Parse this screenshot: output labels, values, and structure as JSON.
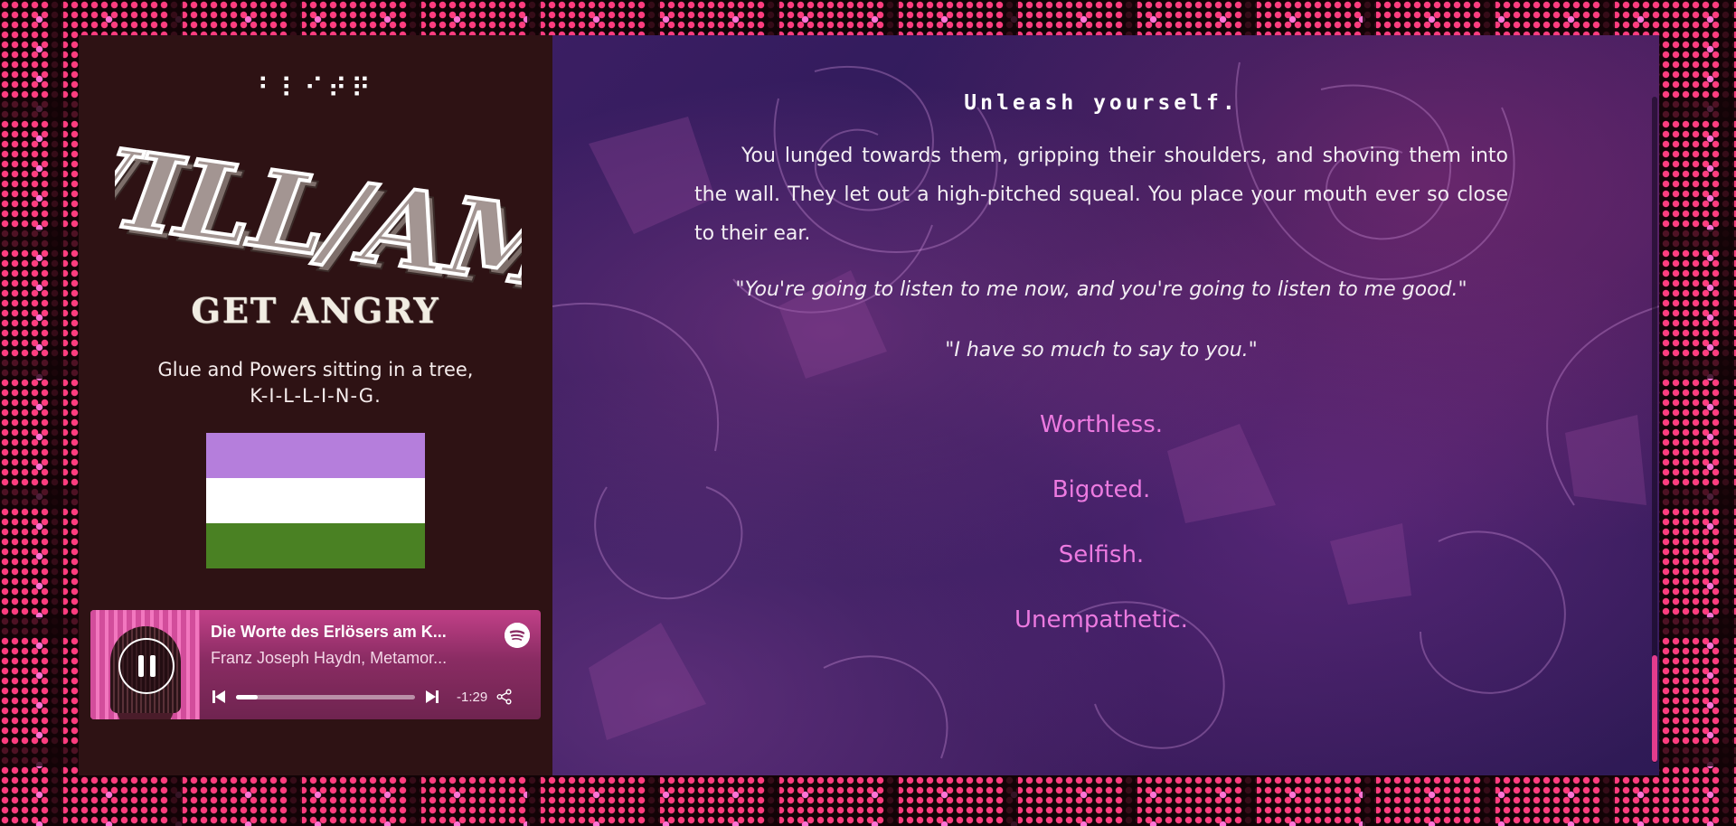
{
  "header": {
    "braille": "⠃⠇⠊⠞⠟",
    "logo_text": "WILL/AM",
    "mood_title": "GET ANGRY",
    "tagline_line1": "Glue and Powers sitting in a tree,",
    "tagline_line2": "K-I-L-L-I-N-G."
  },
  "flag": {
    "stripes": [
      "#b57edc",
      "#ffffff",
      "#4a8123"
    ]
  },
  "player": {
    "track_title": "Die Worte des Erlösers am K...",
    "track_artist": "Franz Joseph Haydn, Metamor...",
    "time_remaining": "-1:29",
    "progress": 0.12,
    "icons": [
      "pause-icon",
      "spotify-icon",
      "previous-icon",
      "next-icon",
      "share-icon"
    ]
  },
  "story": {
    "heading": "Unleash yourself.",
    "paragraph": "You lunged towards them, gripping their shoulders, and shoving them into the wall. They let out a high-pitched squeal. You place your mouth ever so close to their ear.",
    "quote1": "\"You're going to listen to me now, and you're going to listen to me good.\"",
    "quote2": "\"I have so much to say to you.\"",
    "insults": [
      "Worthless.",
      "Bigoted.",
      "Selfish.",
      "Unempathetic."
    ]
  },
  "colors": {
    "accent_pink": "#ec7ae0",
    "scroll_thumb": "#e43c8d",
    "left_panel": "#2e1214"
  }
}
